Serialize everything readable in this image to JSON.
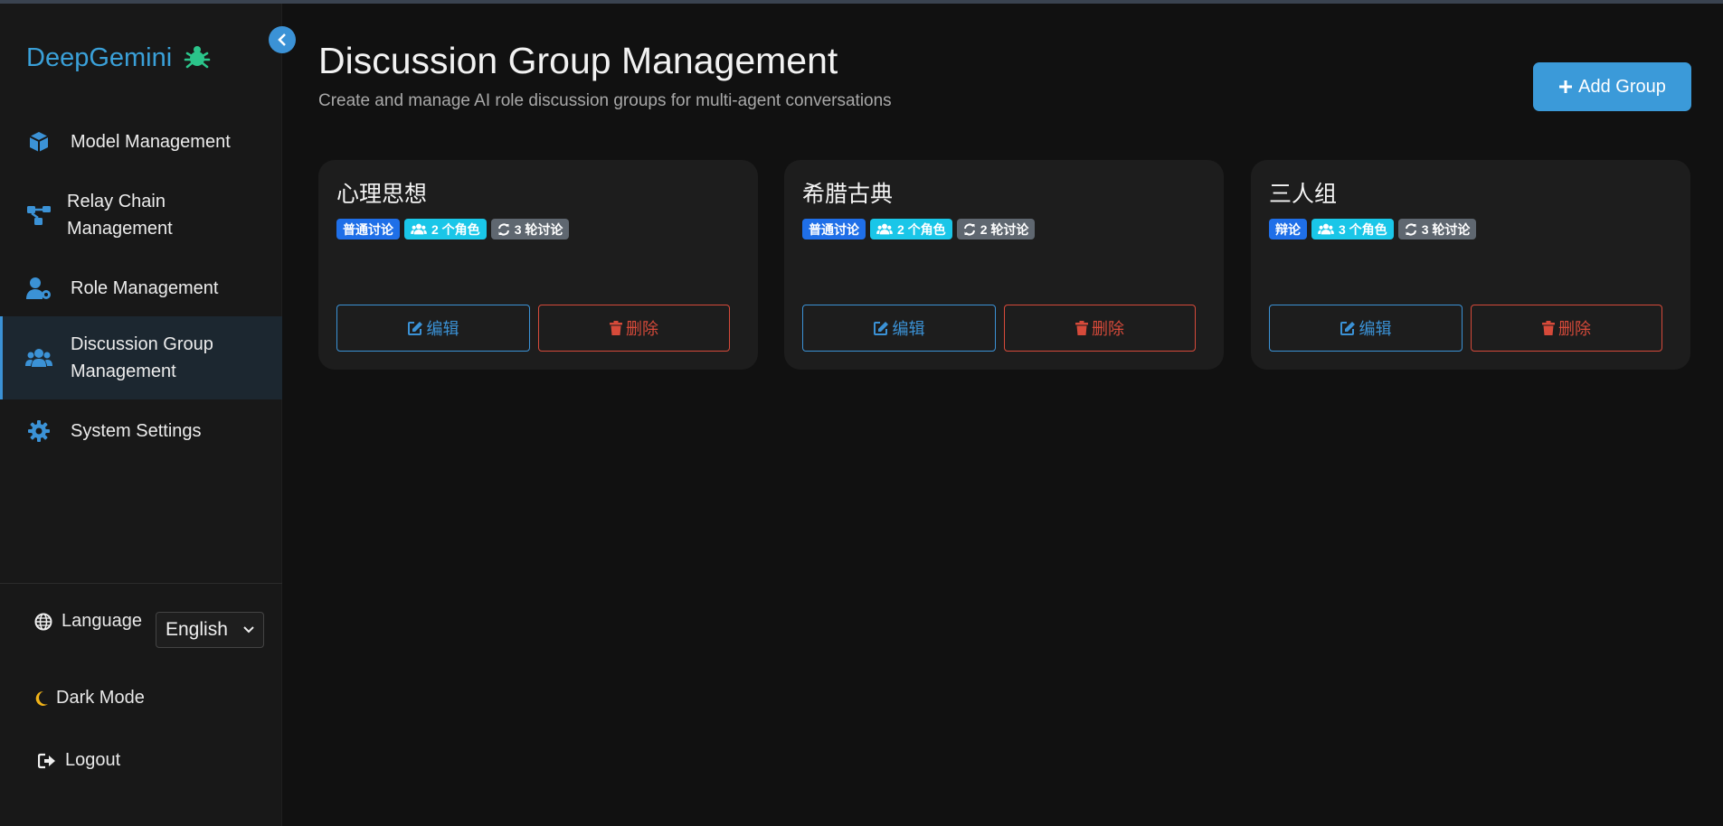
{
  "brand": {
    "name": "DeepGemini",
    "logo_color": "#2bc48a"
  },
  "sidebar": {
    "items": [
      {
        "label": "Model Management",
        "icon": "cube-icon"
      },
      {
        "label": "Relay Chain Management",
        "label_line1": "Relay Chain",
        "label_line2": "Management",
        "icon": "sitemap-icon"
      },
      {
        "label": "Role Management",
        "icon": "user-cog-icon"
      },
      {
        "label": "Discussion Group Management",
        "label_line1": "Discussion Group",
        "label_line2": "Management",
        "icon": "users-icon",
        "active": true
      },
      {
        "label": "System Settings",
        "icon": "gear-icon"
      }
    ],
    "language_label": "Language",
    "language_value": "English",
    "dark_mode_label": "Dark Mode",
    "logout_label": "Logout"
  },
  "header": {
    "title": "Discussion Group Management",
    "subtitle": "Create and manage AI role discussion groups for multi-agent conversations",
    "add_button_label": "Add Group"
  },
  "groups": [
    {
      "name": "心理思想",
      "type": "普通讨论",
      "roles": "2 个角色",
      "rounds": "3 轮讨论",
      "edit_label": "编辑",
      "delete_label": "删除"
    },
    {
      "name": "希腊古典",
      "type": "普通讨论",
      "roles": "2 个角色",
      "rounds": "2 轮讨论",
      "edit_label": "编辑",
      "delete_label": "删除"
    },
    {
      "name": "三人组",
      "type": "辩论",
      "roles": "3 个角色",
      "rounds": "3 轮讨论",
      "edit_label": "编辑",
      "delete_label": "删除"
    }
  ],
  "colors": {
    "accent": "#3b92d6",
    "danger": "#d64a3a",
    "badge_type": "#1f6fe8",
    "badge_roles": "#1ac6e8",
    "badge_rounds": "#5f6770"
  }
}
